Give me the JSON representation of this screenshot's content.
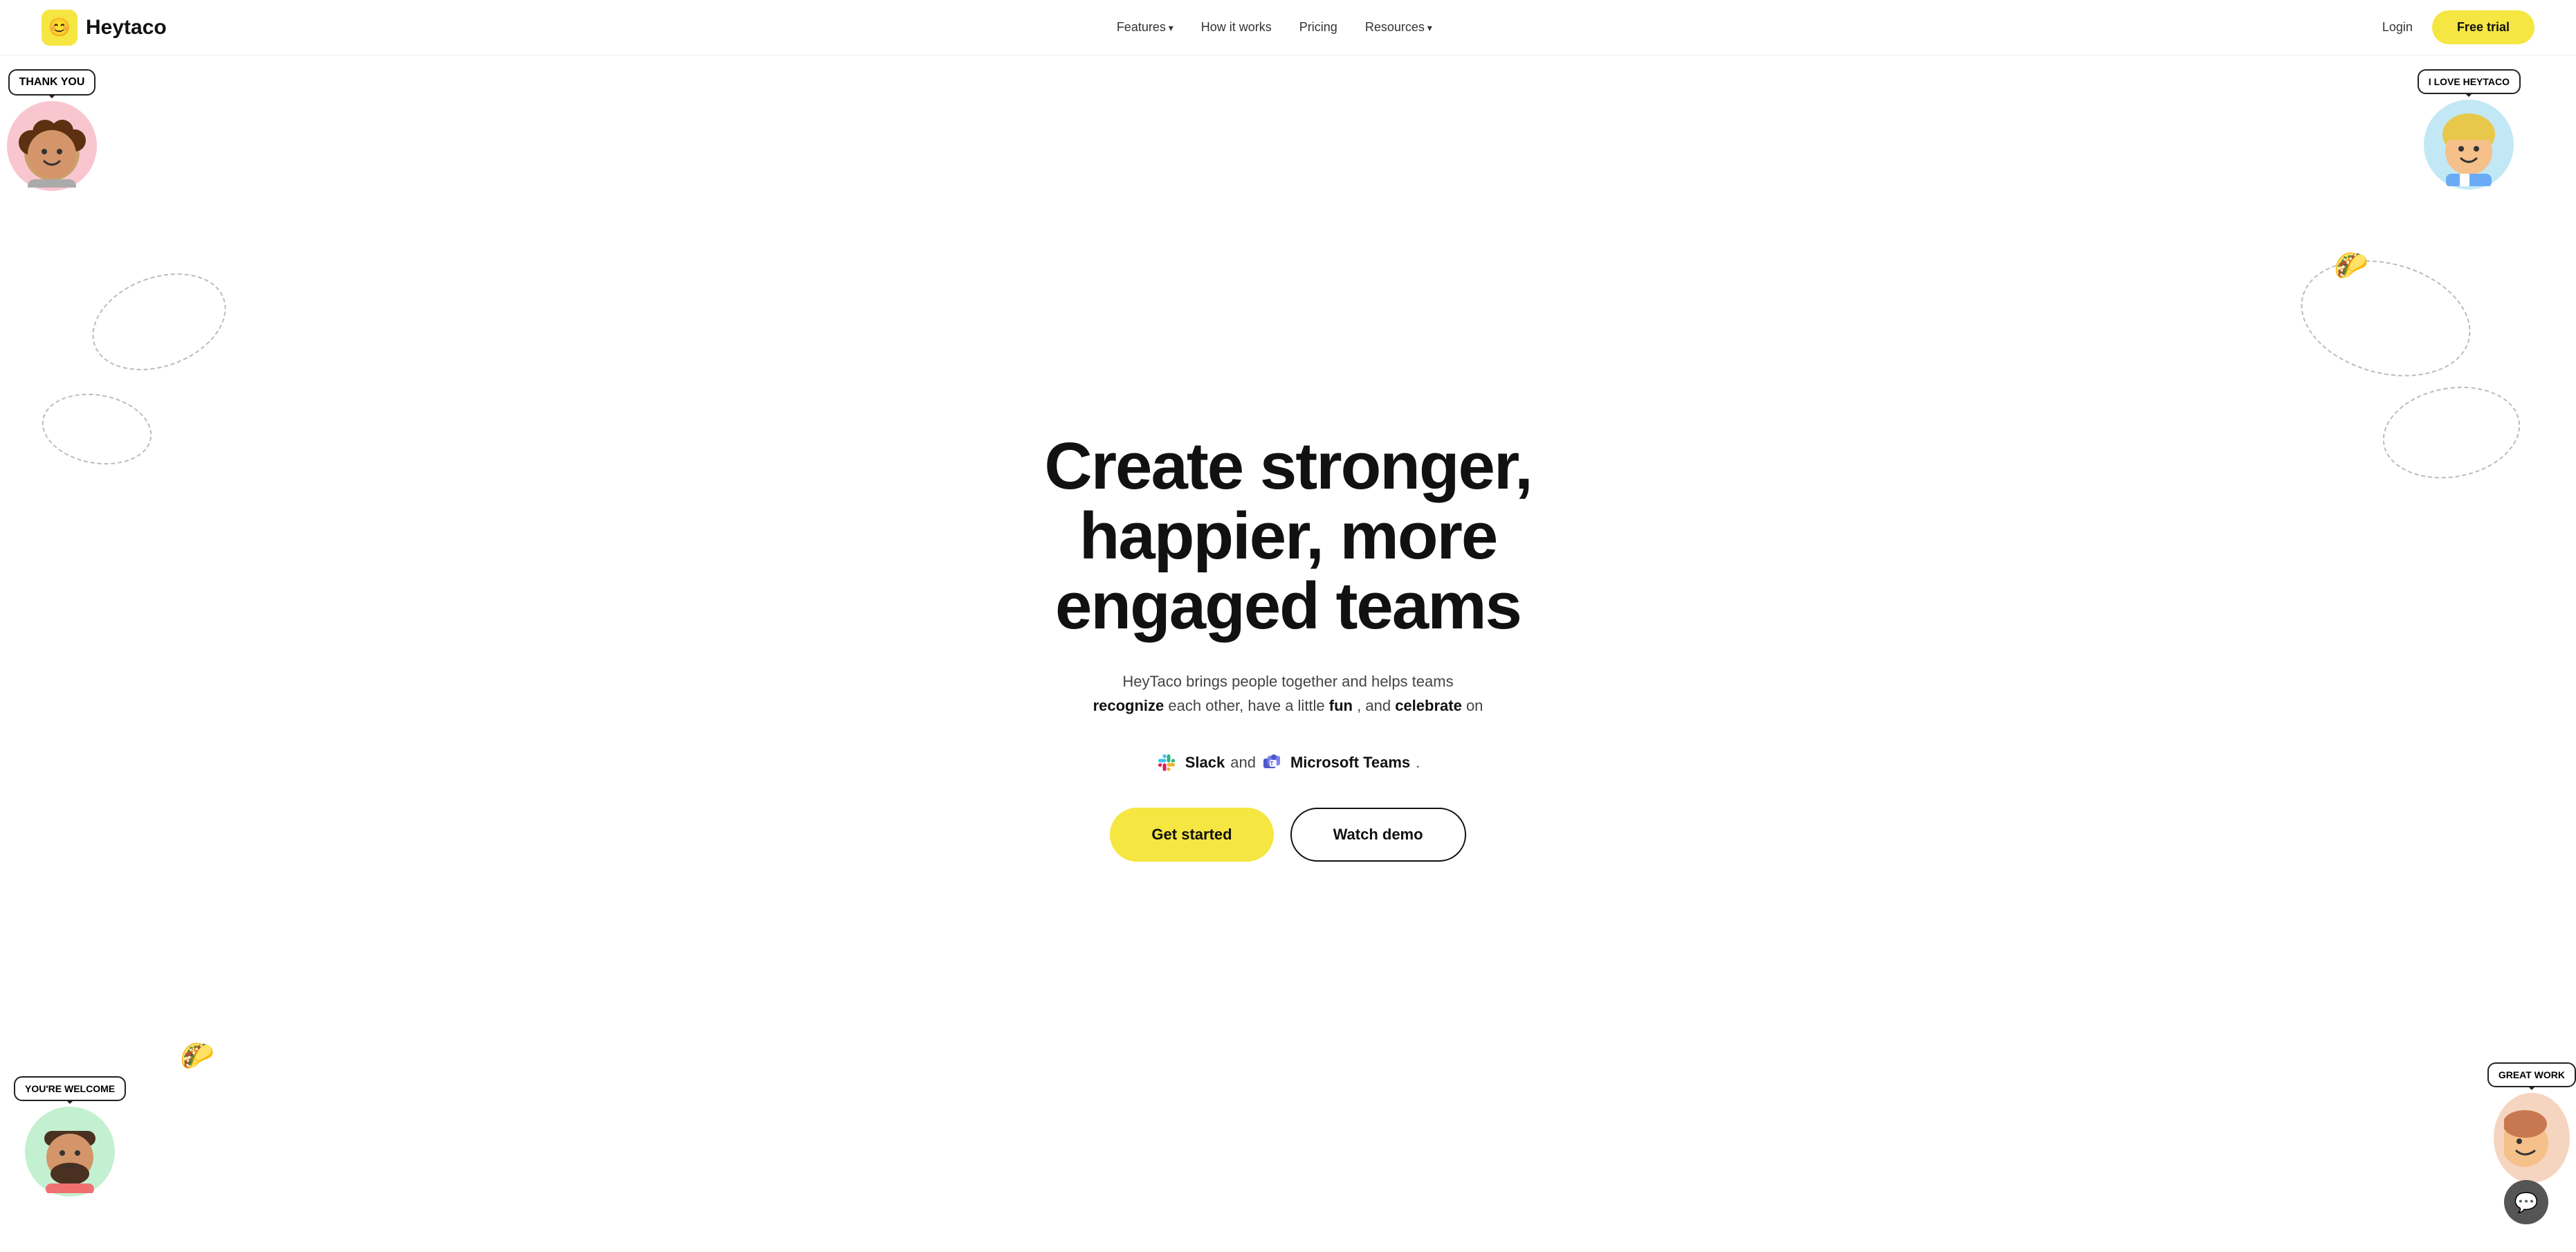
{
  "nav": {
    "logo_icon": "😊",
    "logo_text": "Heytaco",
    "links": [
      {
        "label": "Features",
        "has_dropdown": true
      },
      {
        "label": "How it works",
        "has_dropdown": false
      },
      {
        "label": "Pricing",
        "has_dropdown": false
      },
      {
        "label": "Resources",
        "has_dropdown": true
      }
    ],
    "login_label": "Login",
    "free_trial_label": "Free trial"
  },
  "hero": {
    "headline_line1": "Create stronger,",
    "headline_line2": "happier, more",
    "headline_line3": "engaged teams",
    "subtext_prefix": "HeyTaco brings people together and helps teams",
    "subtext_bold1": "recognize",
    "subtext_mid": "each other, have a little",
    "subtext_bold2": "fun",
    "subtext_and": ", and",
    "subtext_bold3": "celebrate",
    "subtext_suffix": "on",
    "slack_label": "Slack",
    "slack_and": "and",
    "ms_label": "Microsoft Teams",
    "period": ".",
    "btn_get_started": "Get started",
    "btn_watch_demo": "Watch demo"
  },
  "characters": {
    "top_left_bubble": "THANK YOU",
    "top_right_bubble": "I LOVE HEYTACO",
    "bottom_left_bubble": "YOU'RE WELCOME",
    "bottom_right_bubble": "GREAT WORK"
  },
  "chat_widget": {
    "icon": "💬"
  },
  "colors": {
    "accent_yellow": "#f5e642",
    "nav_border": "#eee",
    "text_dark": "#111",
    "text_mid": "#444",
    "btn_outline": "#111"
  }
}
